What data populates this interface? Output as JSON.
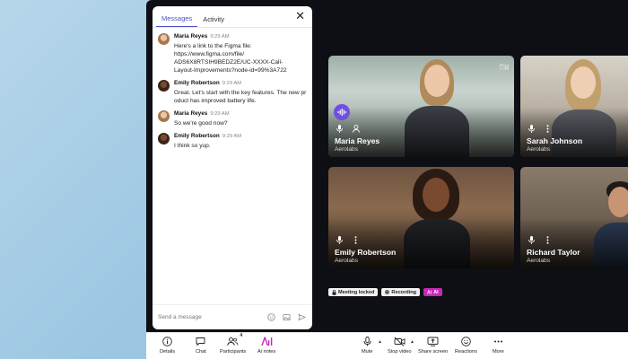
{
  "chat": {
    "tabs": [
      {
        "label": "Messages",
        "active": true
      },
      {
        "label": "Activity",
        "active": false
      }
    ],
    "messages": [
      {
        "name": "Maria Reyes",
        "time": "9:29 AM",
        "text": "Here's a link to the Figma file:\nhttps://www.figma.com/file/\nADS6X8RTSIH9BEDZ2E/UC-XXXX-Call-\nLayout-Improvements?node-id=99%3A722"
      },
      {
        "name": "Emily Robertson",
        "time": "9:29 AM",
        "text": "Great. Let's start with the key features. The new product has improved battery life."
      },
      {
        "name": "Maria Reyes",
        "time": "9:29 AM",
        "text": "So we're good now?"
      },
      {
        "name": "Emily Robertson",
        "time": "9:29 AM",
        "text": "I think so yup."
      }
    ],
    "composer_placeholder": "Send a message"
  },
  "participants": [
    {
      "name": "Maria Reyes",
      "org": "Aerolabs"
    },
    {
      "name": "Sarah Johnson",
      "org": "Aerolabs"
    },
    {
      "name": "Emily Robertson",
      "org": "Aerolabs"
    },
    {
      "name": "Richard Taylor",
      "org": "Aerolabs"
    }
  ],
  "status": {
    "meeting_locked": "Meeting locked",
    "recording": "Recording",
    "ai": "AI"
  },
  "toolbar": {
    "details": "Details",
    "chat": "Chat",
    "participants": "Participants",
    "participants_count": "4",
    "ai_notes": "Ai notes",
    "mute": "Mute",
    "stop_video": "Stop video",
    "share_screen": "Share screen",
    "reactions": "Reactions",
    "more": "More"
  },
  "colors": {
    "accent": "#4b4fc4",
    "speaking": "#6f4ee0",
    "ai_badge": "#c429b8",
    "recording_dot": "#e03131"
  }
}
